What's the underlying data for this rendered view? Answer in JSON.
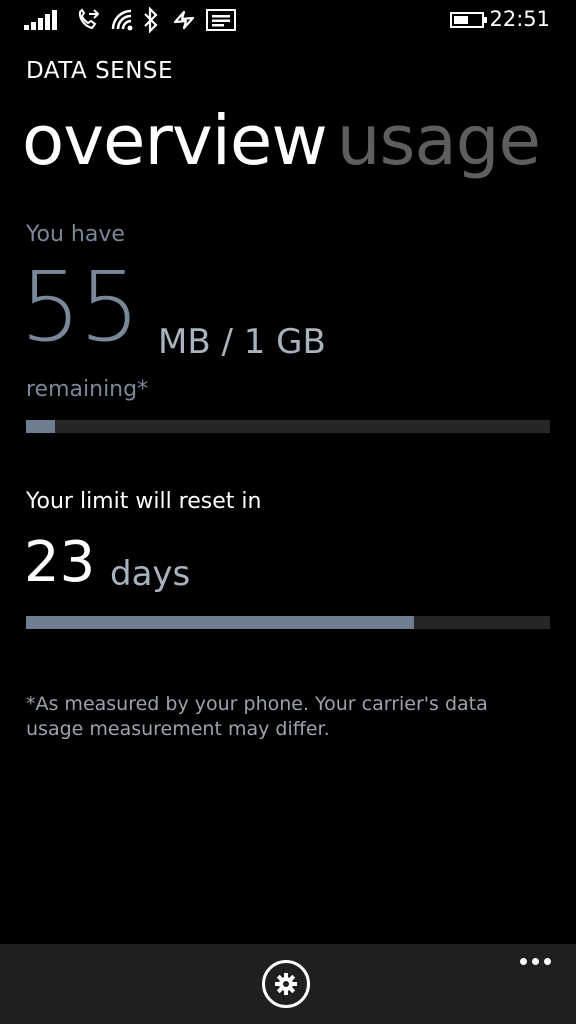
{
  "status_bar": {
    "time": "22:51",
    "icons": [
      "signal-strength-icon",
      "call-forwarding-icon",
      "wifi-icon",
      "bluetooth-icon",
      "data-sense-icon",
      "message-icon",
      "battery-icon"
    ]
  },
  "app": {
    "title": "DATA SENSE"
  },
  "pivot": {
    "items": [
      {
        "label": "overview",
        "active": true
      },
      {
        "label": "usage",
        "active": false
      }
    ]
  },
  "data_remaining": {
    "prefix": "You have",
    "amount": "55",
    "unit": "MB / 1 GB",
    "suffix": "remaining*",
    "used_fraction": 0.055
  },
  "reset": {
    "label": "Your limit will reset in",
    "count": "23",
    "unit": "days",
    "elapsed_fraction": 0.74
  },
  "footnote": "*As measured by your phone. Your carrier's data usage measurement may differ.",
  "app_bar": {
    "buttons": [
      "gear-icon"
    ],
    "more_icon": "more-options-icon"
  },
  "colors": {
    "background": "#000000",
    "accent_steel": "#6f7d90",
    "inactive_text": "#5e5e5e",
    "track": "#262626",
    "app_bar": "#1f1f1f"
  }
}
